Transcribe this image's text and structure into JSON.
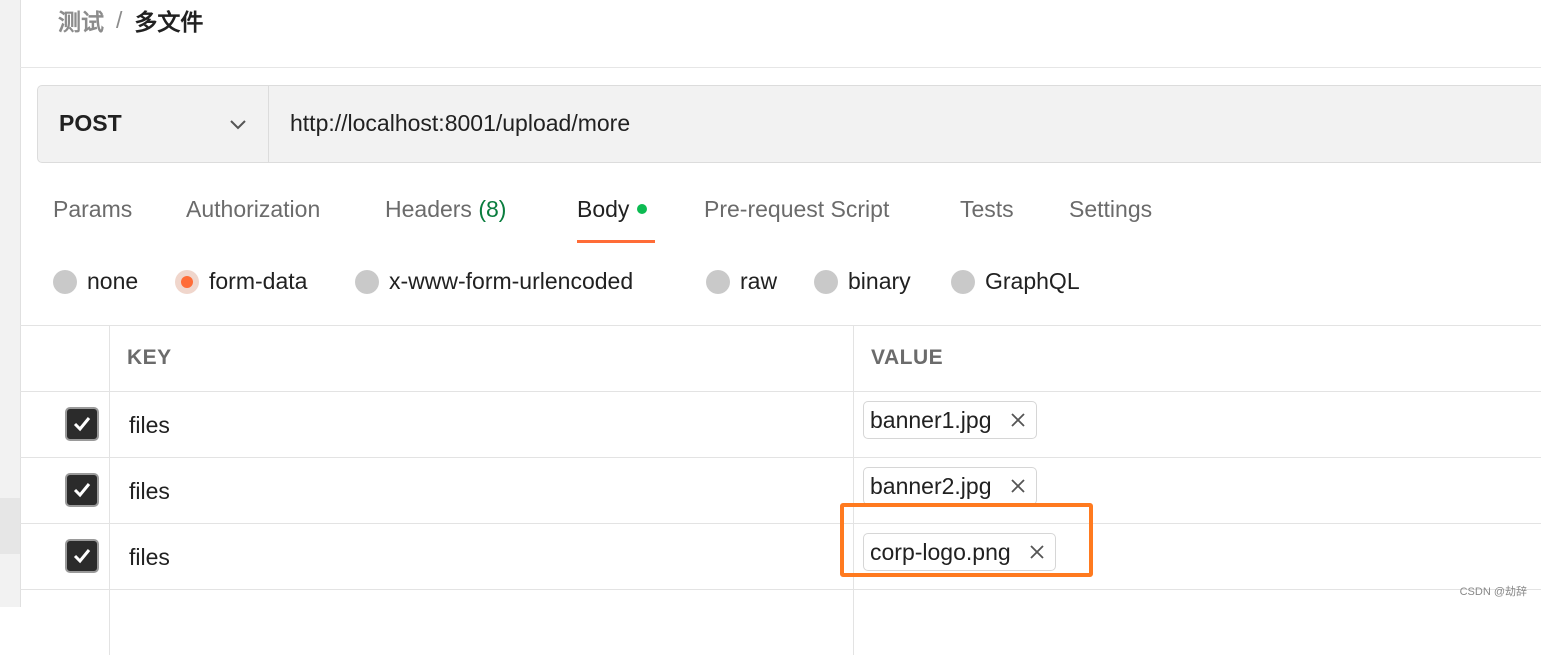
{
  "breadcrumb": {
    "parent": "测试",
    "separator": "/",
    "current": "多文件"
  },
  "request": {
    "method": "POST",
    "url": "http://localhost:8001/upload/more"
  },
  "tabs": [
    {
      "label": "Params"
    },
    {
      "label": "Authorization"
    },
    {
      "label": "Headers",
      "count": "(8)"
    },
    {
      "label": "Body",
      "active": true,
      "indicator": "green-dot"
    },
    {
      "label": "Pre-request Script"
    },
    {
      "label": "Tests"
    },
    {
      "label": "Settings"
    }
  ],
  "body_types": [
    {
      "label": "none"
    },
    {
      "label": "form-data",
      "selected": true
    },
    {
      "label": "x-www-form-urlencoded"
    },
    {
      "label": "raw"
    },
    {
      "label": "binary"
    },
    {
      "label": "GraphQL"
    }
  ],
  "table": {
    "headers": {
      "key": "KEY",
      "value": "VALUE"
    },
    "rows": [
      {
        "checked": true,
        "key": "files",
        "file": "banner1.jpg"
      },
      {
        "checked": true,
        "key": "files",
        "file": "banner2.jpg"
      },
      {
        "checked": true,
        "key": "files",
        "file": "corp-logo.png"
      }
    ]
  },
  "colors": {
    "accent": "#ff6c37",
    "active_dot": "#0cbb52",
    "highlight": "#ff7a1f"
  },
  "watermark": "CSDN @劫辞"
}
